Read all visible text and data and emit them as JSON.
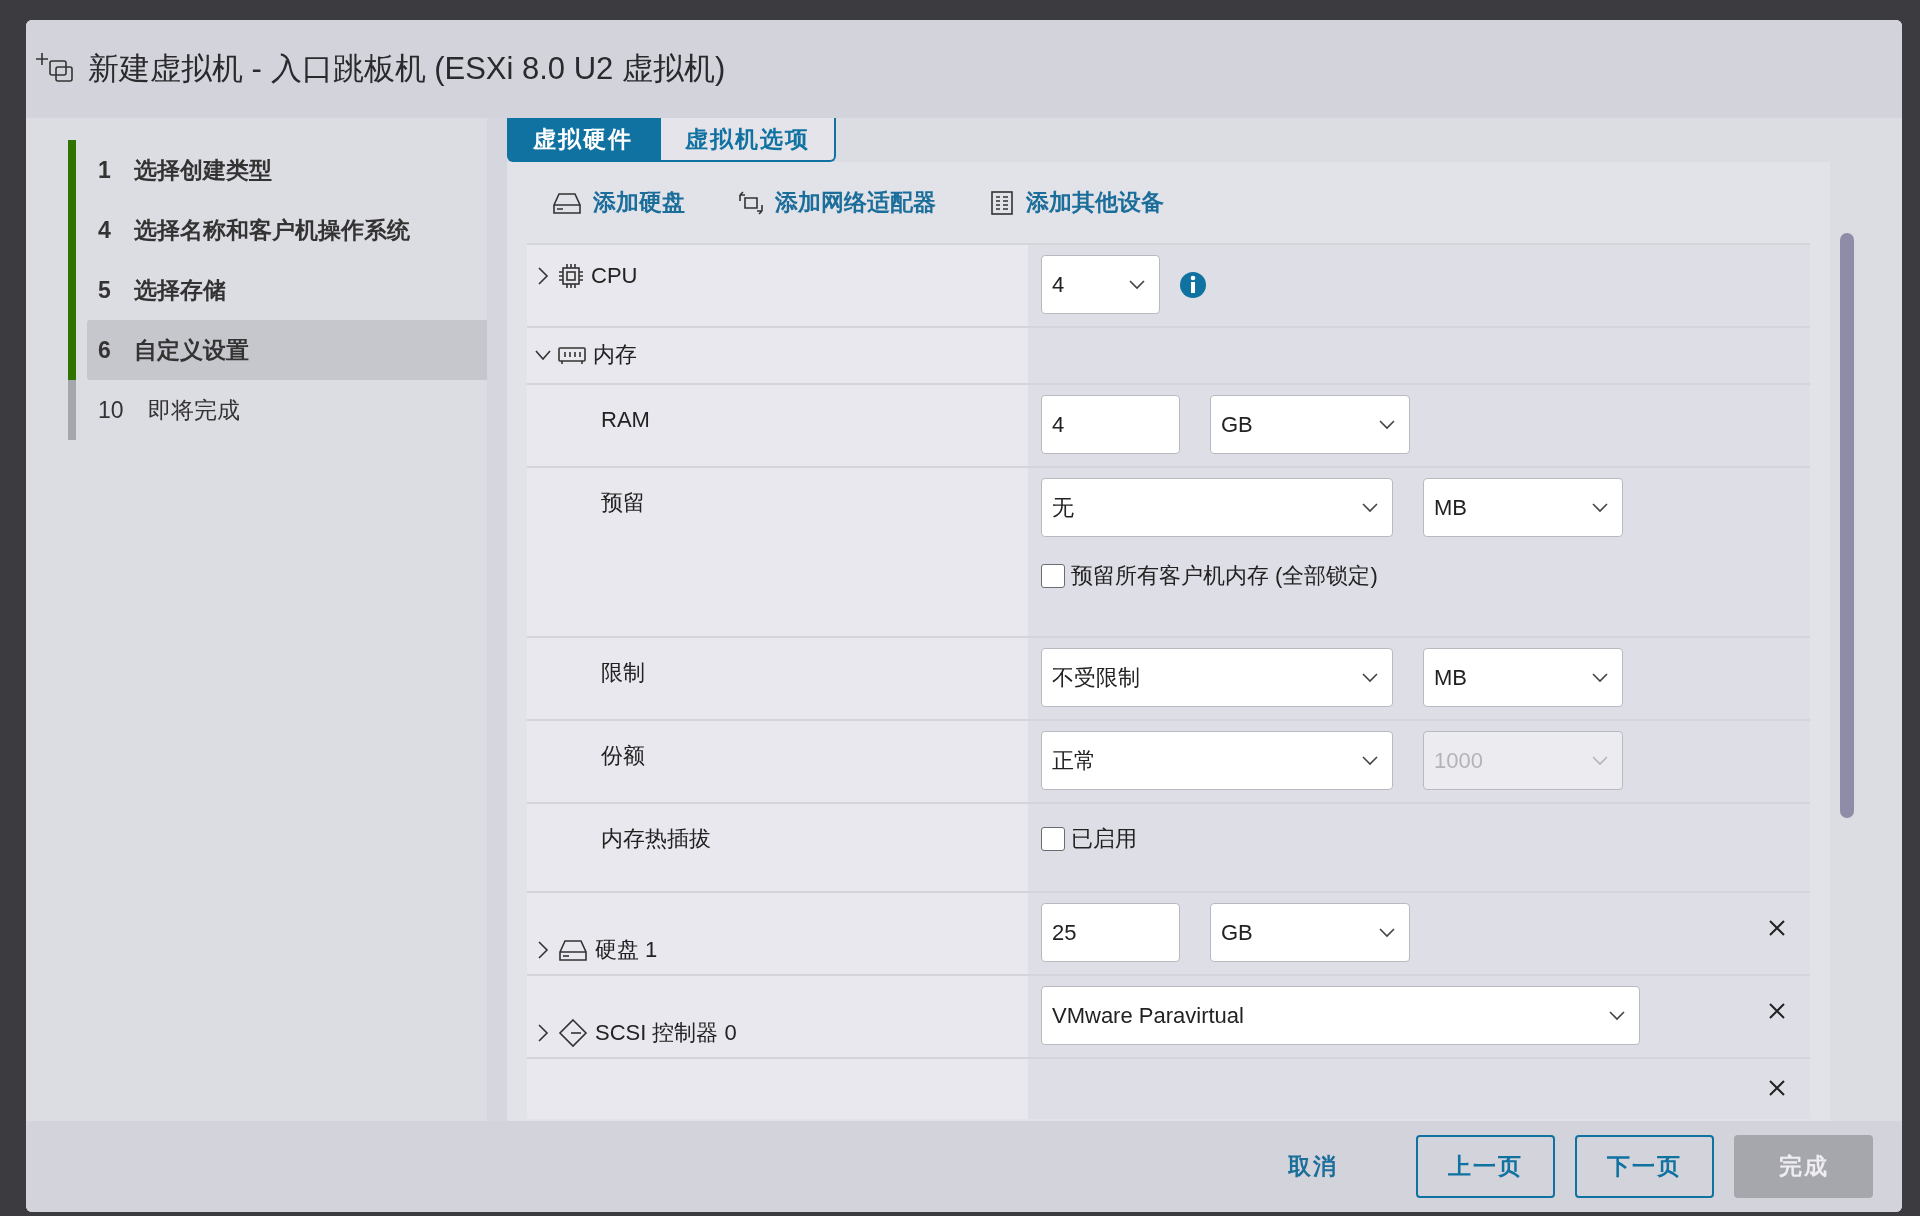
{
  "dialog": {
    "title": "新建虚拟机 - 入口跳板机 (ESXi 8.0 U2 虚拟机)"
  },
  "steps": [
    {
      "number": "1",
      "label": "选择创建类型",
      "completed": true,
      "selected": false
    },
    {
      "number": "4",
      "label": "选择名称和客户机操作系统",
      "completed": true,
      "selected": false
    },
    {
      "number": "5",
      "label": "选择存储",
      "completed": true,
      "selected": false
    },
    {
      "number": "6",
      "label": "自定义设置",
      "completed": true,
      "selected": true
    },
    {
      "number": "10",
      "label": "即将完成",
      "completed": false,
      "selected": false
    }
  ],
  "tabs": [
    {
      "label": "虚拟硬件",
      "selected": true
    },
    {
      "label": "虚拟机选项",
      "selected": false
    }
  ],
  "toolbar": [
    {
      "label": "添加硬盘",
      "kind": "disk"
    },
    {
      "label": "添加网络适配器",
      "kind": "network"
    },
    {
      "label": "添加其他设备",
      "kind": "other"
    }
  ],
  "rows": [
    {
      "kind": "cpu",
      "label": "CPU",
      "expanded": false,
      "info": true,
      "controls": [
        {
          "kind": "count-select",
          "value": "4",
          "disabled": false
        }
      ]
    },
    {
      "kind": "memory",
      "label": "内存",
      "expanded": true,
      "controls": []
    },
    {
      "kind": "setting",
      "label": "RAM",
      "controls": [
        {
          "kind": "number-input",
          "value": "4"
        },
        {
          "kind": "unit-select",
          "value": "GB",
          "disabled": false
        }
      ]
    },
    {
      "kind": "setting",
      "label": "预留",
      "controls": [
        {
          "kind": "option-select",
          "value": "无",
          "disabled": false
        },
        {
          "kind": "unit-select",
          "value": "MB",
          "disabled": false
        }
      ],
      "checkbox": {
        "label": "预留所有客户机内存 (全部锁定)",
        "checked": false
      }
    },
    {
      "kind": "setting",
      "label": "限制",
      "controls": [
        {
          "kind": "option-select",
          "value": "不受限制",
          "disabled": false
        },
        {
          "kind": "unit-select",
          "value": "MB",
          "disabled": false
        }
      ]
    },
    {
      "kind": "setting",
      "label": "份额",
      "controls": [
        {
          "kind": "option-select",
          "value": "正常",
          "disabled": false
        },
        {
          "kind": "unit-select",
          "value": "1000",
          "disabled": true
        }
      ]
    },
    {
      "kind": "setting",
      "label": "内存热插拔",
      "controls": [],
      "checkbox": {
        "label": "已启用",
        "checked": false
      }
    },
    {
      "kind": "disk",
      "label": "硬盘 1",
      "expanded": false,
      "removable": true,
      "controls": [
        {
          "kind": "number-input",
          "value": "25"
        },
        {
          "kind": "unit-select",
          "value": "GB",
          "disabled": false
        }
      ]
    },
    {
      "kind": "scsi",
      "label": "SCSI 控制器 0",
      "expanded": false,
      "removable": true,
      "controls": [
        {
          "kind": "type-select",
          "value": "VMware Paravirtual",
          "disabled": false
        }
      ]
    },
    {
      "kind": "partial",
      "removable": true
    }
  ],
  "footer": [
    {
      "label": "取消",
      "kind": "link"
    },
    {
      "label": "上一页",
      "kind": "outline"
    },
    {
      "label": "下一页",
      "kind": "outline"
    },
    {
      "label": "完成",
      "kind": "solid",
      "disabled": true
    }
  ]
}
